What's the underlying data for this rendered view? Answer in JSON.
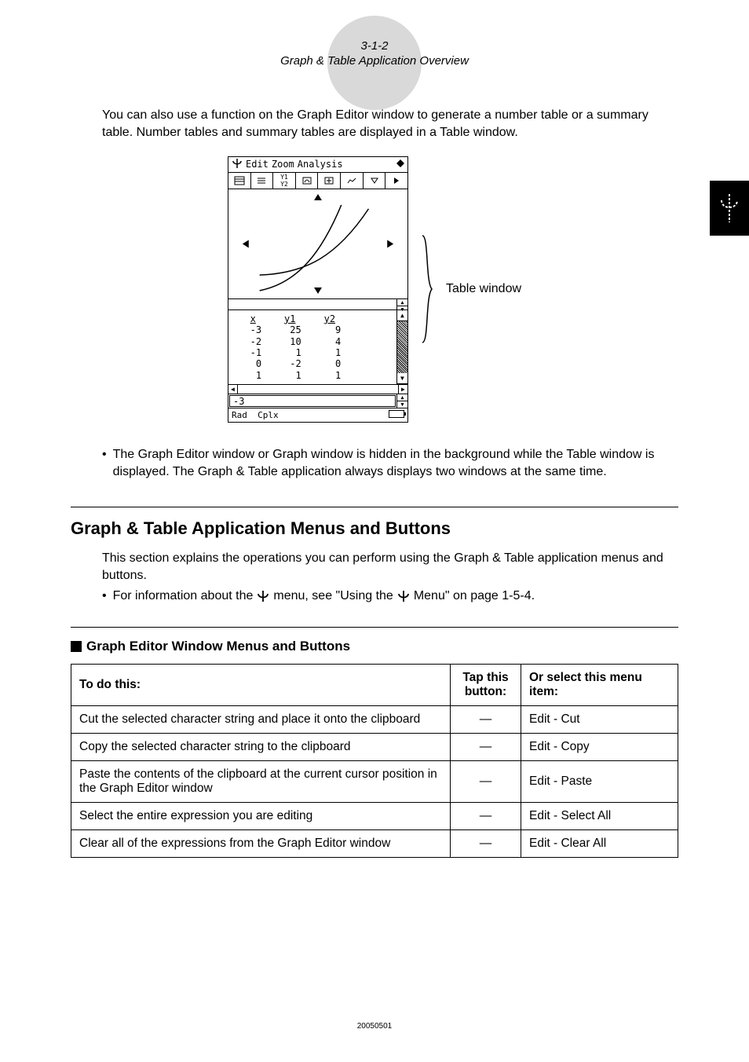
{
  "page_header": {
    "number": "3-1-2",
    "title": "Graph & Table Application Overview"
  },
  "intro_paragraph": "You can also use a function on the Graph Editor window to generate a number table or a summary table. Number tables and summary tables are displayed in a Table window.",
  "screenshot": {
    "menubar": {
      "edit": "Edit",
      "zoom": "Zoom",
      "analysis": "Analysis"
    },
    "table": {
      "headers": [
        "x",
        "y1",
        "y2"
      ],
      "rows": [
        {
          "x": "-3",
          "y1": "25",
          "y2": "9"
        },
        {
          "x": "-2",
          "y1": "10",
          "y2": "4"
        },
        {
          "x": "-1",
          "y1": "1",
          "y2": "1"
        },
        {
          "x": "0",
          "y1": "-2",
          "y2": "0"
        },
        {
          "x": "1",
          "y1": "1",
          "y2": "1"
        }
      ]
    },
    "current_value": "-3",
    "status": {
      "rad": "Rad",
      "cplx": "Cplx"
    }
  },
  "table_window_label": "Table window",
  "note_paragraph": "The Graph Editor window or Graph window is hidden in the background while the Table window is displayed. The Graph & Table application always displays two windows at the same time.",
  "section_heading": "Graph & Table Application Menus and Buttons",
  "section_paragraph": "This section explains the operations you can perform using the Graph & Table application menus and buttons.",
  "info_bullet": {
    "part1": "For information about the ",
    "part2": " menu, see \"Using the ",
    "part3": " Menu\" on page 1-5-4."
  },
  "subsection_heading": "Graph Editor Window Menus and Buttons",
  "ops_table": {
    "headers": {
      "todo": "To do this:",
      "button": "Tap this button:",
      "menu": "Or select this menu item:"
    },
    "rows": [
      {
        "todo": "Cut the selected character string and place it onto the clipboard",
        "button": "—",
        "menu": "Edit - Cut"
      },
      {
        "todo": "Copy the selected character string to the clipboard",
        "button": "—",
        "menu": "Edit - Copy"
      },
      {
        "todo": "Paste the contents of the clipboard at the current cursor position in the Graph Editor window",
        "button": "—",
        "menu": "Edit - Paste"
      },
      {
        "todo": "Select the entire expression you are editing",
        "button": "—",
        "menu": "Edit - Select All"
      },
      {
        "todo": "Clear all of the expressions from the Graph Editor window",
        "button": "—",
        "menu": "Edit - Clear All"
      }
    ]
  },
  "footer_stamp": "20050501",
  "chart_data": {
    "type": "table",
    "title": "Graph Editor Window Menus and Buttons",
    "columns": [
      "To do this:",
      "Tap this button:",
      "Or select this menu item:"
    ],
    "rows": [
      [
        "Cut the selected character string and place it onto the clipboard",
        "—",
        "Edit - Cut"
      ],
      [
        "Copy the selected character string to the clipboard",
        "—",
        "Edit - Copy"
      ],
      [
        "Paste the contents of the clipboard at the current cursor position in the Graph Editor window",
        "—",
        "Edit - Paste"
      ],
      [
        "Select the entire expression you are editing",
        "—",
        "Edit - Select All"
      ],
      [
        "Clear all of the expressions from the Graph Editor window",
        "—",
        "Edit - Clear All"
      ]
    ]
  }
}
